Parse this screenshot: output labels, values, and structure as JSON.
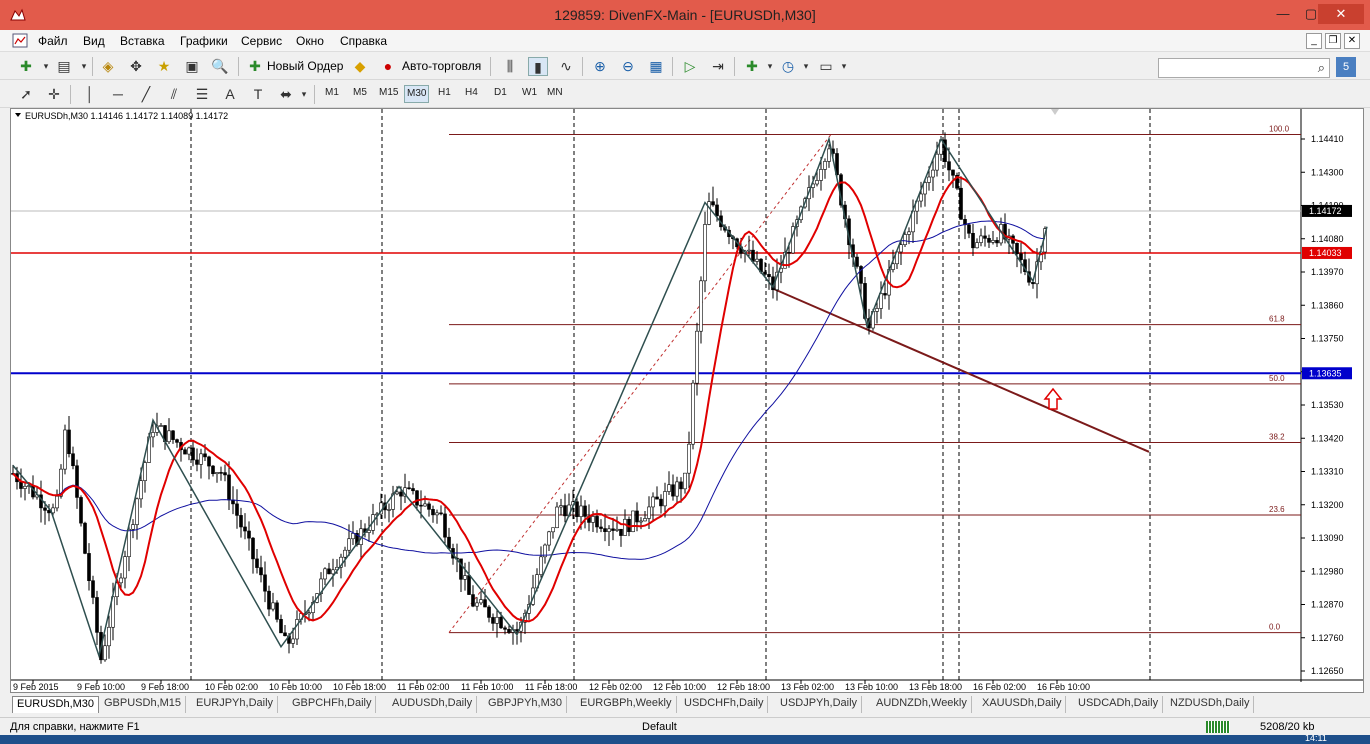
{
  "window": {
    "title": "129859: DivenFX-Main - [EURUSDh,M30]"
  },
  "menu": [
    "Файл",
    "Вид",
    "Вставка",
    "Графики",
    "Сервис",
    "Окно",
    "Справка"
  ],
  "toolbar": {
    "new_order": "Новый Ордер",
    "auto_trading": "Авто-торговля",
    "timeframes": [
      "M1",
      "M5",
      "M15",
      "M30",
      "H1",
      "H4",
      "D1",
      "W1",
      "MN"
    ],
    "active_timeframe": "M30",
    "notification_count": "5"
  },
  "chart": {
    "header": "EURUSDh,M30  1.14146 1.14172 1.14089 1.14172",
    "fib_levels": [
      {
        "label": "100.0",
        "price": 1.14425
      },
      {
        "label": "61.8",
        "price": 1.13796
      },
      {
        "label": "50.0",
        "price": 1.136
      },
      {
        "label": "38.2",
        "price": 1.13406
      },
      {
        "label": "23.6",
        "price": 1.13166
      },
      {
        "label": "0.0",
        "price": 1.12777
      }
    ],
    "price_ticks": [
      "1.14410",
      "1.14300",
      "1.14190",
      "1.14080",
      "1.13970",
      "1.13860",
      "1.13750",
      "1.13640",
      "1.13530",
      "1.13420",
      "1.13310",
      "1.13200",
      "1.13090",
      "1.12980",
      "1.12870",
      "1.12760",
      "1.12650"
    ],
    "current_price": "1.14172",
    "red_line_price": "1.14033",
    "blue_line_price": "1.13635",
    "time_labels": [
      "9 Feb 2015",
      "9 Feb 10:00",
      "9 Feb 18:00",
      "10 Feb 02:00",
      "10 Feb 10:00",
      "10 Feb 18:00",
      "11 Feb 02:00",
      "11 Feb 10:00",
      "11 Feb 18:00",
      "12 Feb 02:00",
      "12 Feb 10:00",
      "12 Feb 18:00",
      "13 Feb 02:00",
      "13 Feb 10:00",
      "13 Feb 18:00",
      "16 Feb 02:00",
      "16 Feb 10:00"
    ]
  },
  "symbol_tabs": [
    "EURUSDh,M30",
    "GBPUSDh,M15",
    "EURJPYh,Daily",
    "GBPCHFh,Daily",
    "AUDUSDh,Daily",
    "GBPJPYh,M30",
    "EURGBPh,Weekly",
    "USDCHFh,Daily",
    "USDJPYh,Daily",
    "AUDNZDh,Weekly",
    "XAUUSDh,Daily",
    "USDCADh,Daily",
    "NZDUSDh,Daily"
  ],
  "status": {
    "help": "Для справки, нажмите F1",
    "profile": "Default",
    "traffic": "5208/20 kb",
    "clock": "14:11"
  },
  "colors": {
    "title_bar": "#e25b4b",
    "fib": "#7b1a1a",
    "price_red": "#e00000",
    "price_blue": "#0000cc",
    "ma_fast": "#e00000",
    "ma_slow": "#1010a0",
    "zigzag": "#2f4f4f"
  }
}
